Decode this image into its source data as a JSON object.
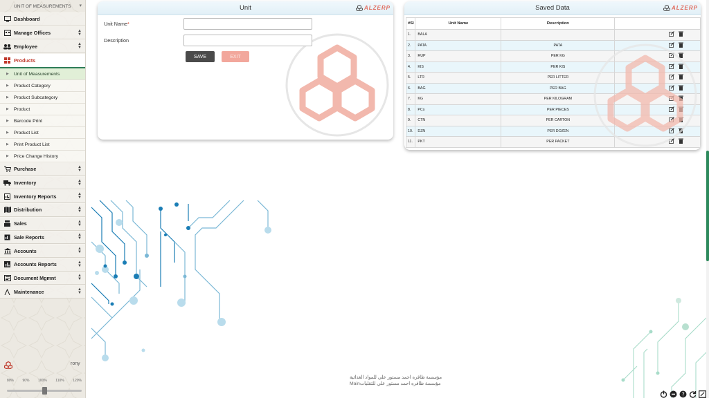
{
  "sidebar": {
    "current_page": "UNIT OF MEASUREMENTS",
    "menu_top": [
      {
        "label": "Dashboard",
        "icon": "monitor-icon"
      },
      {
        "label": "Manage Offices",
        "icon": "building-icon"
      },
      {
        "label": "Employee",
        "icon": "users-icon"
      },
      {
        "label": "Products",
        "icon": "grid-icon"
      }
    ],
    "submenu": [
      "Unit of Measurements",
      "Product Category",
      "Product Subcategory",
      "Product",
      "Barcode Print",
      "Product List",
      "Print Product List",
      "Price Change History"
    ],
    "menu_bottom": [
      {
        "label": "Purchase",
        "icon": "cart-icon"
      },
      {
        "label": "Inventory",
        "icon": "truck-icon"
      },
      {
        "label": "Inventory Reports",
        "icon": "report-icon"
      },
      {
        "label": "Distribution",
        "icon": "map-icon"
      },
      {
        "label": "Sales",
        "icon": "register-icon"
      },
      {
        "label": "Sale Reports",
        "icon": "report-icon"
      },
      {
        "label": "Accounts",
        "icon": "bank-icon"
      },
      {
        "label": "Accounts Reports",
        "icon": "chart-icon"
      },
      {
        "label": "Document Mgmnt",
        "icon": "document-icon"
      },
      {
        "label": "Maintenance",
        "icon": "wrench-icon"
      }
    ],
    "user": "rony",
    "zoom_levels": [
      "80%",
      "90%",
      "100%",
      "110%",
      "120%"
    ],
    "zoom_value": "100%"
  },
  "unit_form": {
    "title": "Unit",
    "brand": "ALZERP",
    "unit_name_label": "Unit Name",
    "required_mark": "*",
    "description_label": "Description",
    "unit_name_value": "",
    "description_value": "",
    "save_label": "SAVE",
    "exit_label": "EXIT"
  },
  "saved_data": {
    "title": "Saved Data",
    "brand": "ALZERP",
    "columns": [
      "#Sl",
      "Unit Name",
      "Description",
      ""
    ],
    "rows": [
      {
        "sl": "1.",
        "name": "BALA",
        "desc": ""
      },
      {
        "sl": "2.",
        "name": "PATA",
        "desc": "PATA"
      },
      {
        "sl": "3.",
        "name": "RUP",
        "desc": "PER KG"
      },
      {
        "sl": "4.",
        "name": "KIS",
        "desc": "PER KIS"
      },
      {
        "sl": "5.",
        "name": "LTR",
        "desc": "PER LITTER"
      },
      {
        "sl": "6.",
        "name": "BAG",
        "desc": "PER BAG"
      },
      {
        "sl": "7.",
        "name": "KG",
        "desc": "PER KILOGRAM"
      },
      {
        "sl": "8.",
        "name": "PCs",
        "desc": "PER PIECES"
      },
      {
        "sl": "9.",
        "name": "CTN",
        "desc": "PER CARTON"
      },
      {
        "sl": "10.",
        "name": "DZN",
        "desc": "PER DOZEN"
      },
      {
        "sl": "11.",
        "name": "PKT",
        "desc": "PER PACKET"
      }
    ]
  },
  "footer": {
    "line1": "مؤسسة ظافره احمد مستور علي للمواد الغذائية",
    "line2": "Mainمؤسسة ظافره احمد مستور علي للتقليات"
  },
  "colors": {
    "accent_green": "#2e7d57",
    "brand_red": "#e06a5c",
    "circuit_blue": "#1a7db5"
  }
}
